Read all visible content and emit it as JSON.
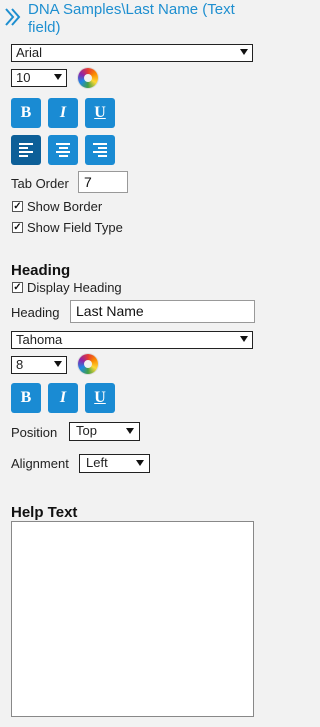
{
  "header": {
    "title": "DNA Samples\\Last Name (Text field)",
    "collapse_icon": "double-chevron-right-icon"
  },
  "field_font": {
    "family": "Arial",
    "size": "10",
    "bold_label": "B",
    "italic_label": "I",
    "underline_label": "U",
    "align_active": "left"
  },
  "tab_order": {
    "label": "Tab Order",
    "value": "7"
  },
  "show_border": {
    "label": "Show Border",
    "checked": true
  },
  "show_field_type": {
    "label": "Show Field Type",
    "checked": true
  },
  "heading_section": {
    "title": "Heading",
    "display_heading": {
      "label": "Display Heading",
      "checked": true
    },
    "heading_label": "Heading",
    "heading_value": "Last Name",
    "font_family": "Tahoma",
    "font_size": "8",
    "bold_label": "B",
    "italic_label": "I",
    "underline_label": "U",
    "position_label": "Position",
    "position_value": "Top",
    "alignment_label": "Alignment",
    "alignment_value": "Left"
  },
  "help_text": {
    "title": "Help Text",
    "value": ""
  },
  "colors": {
    "accent": "#1a8bd3",
    "accent_active": "#0d5f98",
    "title": "#1e8fd0",
    "panel_bg": "#f2f2f2"
  }
}
